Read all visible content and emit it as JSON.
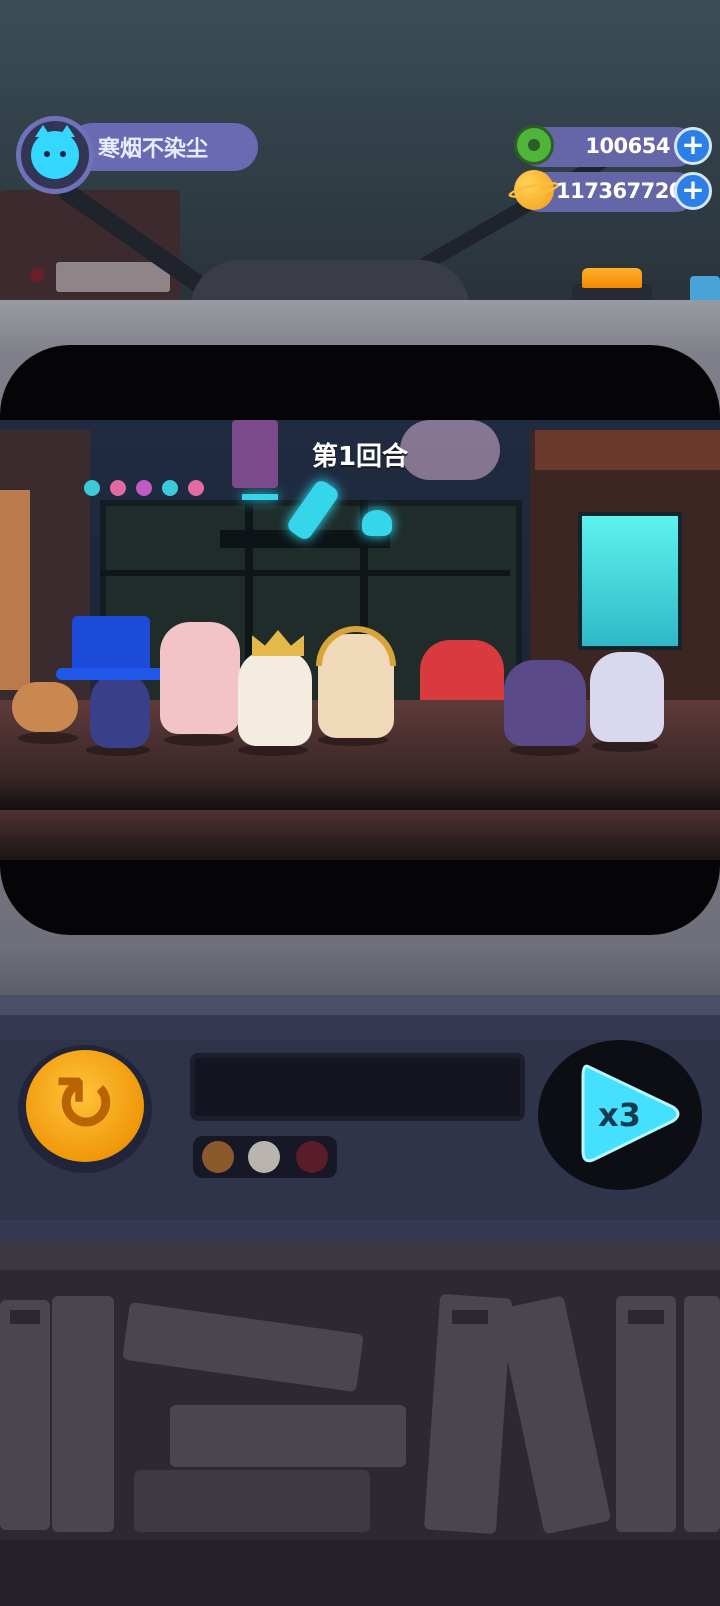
{
  "player": {
    "name": "寒烟不染尘"
  },
  "currencies": [
    {
      "name": "donut",
      "value": "100654"
    },
    {
      "name": "planet-coin",
      "value": "117367720"
    }
  ],
  "battle": {
    "round_label": "第1回合"
  },
  "controls": {
    "reset_icon": "↻",
    "speed_label": "x3"
  },
  "colors": {
    "accent_blue": "#2b7fe6",
    "player_plate": "#6a6ab2",
    "reset_orange": "#f0980a",
    "speed_cyan": "#46e0ff"
  }
}
